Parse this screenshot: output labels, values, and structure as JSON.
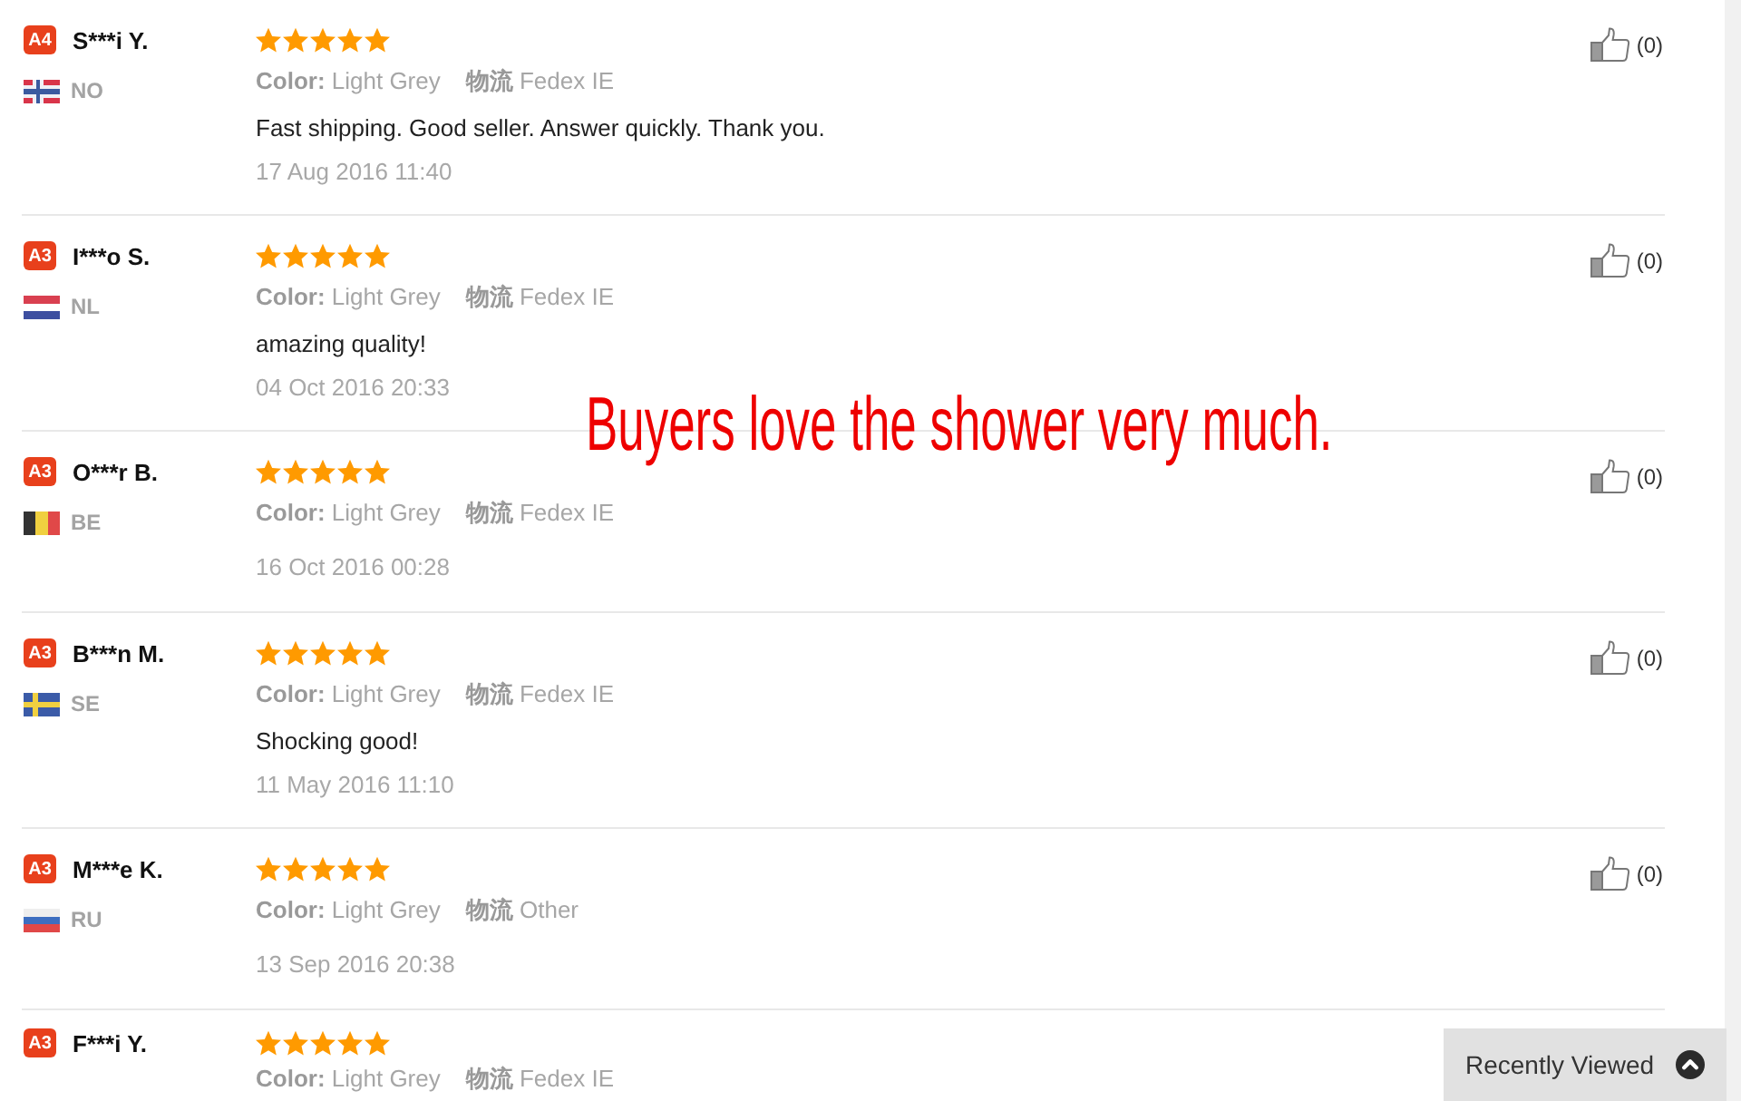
{
  "reviews": [
    {
      "badge": "A4",
      "name": "S***i Y.",
      "flag": {
        "kind": "cross",
        "parts": [
          {
            "color": "#d9354a"
          },
          {
            "color": "#f0f0f6"
          },
          {
            "color": "#3b5aa0"
          }
        ]
      },
      "country": "NO",
      "stars": 5,
      "attributes": [
        "**Color:** Light Grey",
        "**物流** Fedex IE"
      ],
      "comment": "Fast shipping. Good seller. Answer quickly. Thank you.",
      "date": "17 Aug 2016 11:40",
      "helpful": "(0)"
    },
    {
      "badge": "A3",
      "name": "I***o S.",
      "flag": {
        "kind": "horizontal",
        "parts": [
          {
            "color": "#d94050"
          },
          {
            "color": "#ffffff"
          },
          {
            "color": "#3d4fa0"
          }
        ]
      },
      "country": "NL",
      "stars": 5,
      "attributes": [
        "**Color:** Light Grey",
        "**物流** Fedex IE"
      ],
      "comment": "amazing quality!",
      "date": "04 Oct 2016 20:33",
      "helpful": "(0)"
    },
    {
      "badge": "A3",
      "name": "O***r B.",
      "flag": {
        "kind": "vertical",
        "parts": [
          {
            "color": "#333333"
          },
          {
            "color": "#f0d040"
          },
          {
            "color": "#e04848"
          }
        ]
      },
      "country": "BE",
      "stars": 5,
      "attributes": [
        "**Color:** Light Grey",
        "**物流** Fedex IE"
      ],
      "date": "16 Oct 2016 00:28",
      "helpful": "(0)"
    },
    {
      "badge": "A3",
      "name": "B***n M.",
      "flag": {
        "kind": "cross",
        "parts": [
          {
            "color": "#3b5ba8"
          },
          {
            "color": "#f0d040"
          }
        ]
      },
      "country": "SE",
      "stars": 5,
      "attributes": [
        "**Color:** Light Grey",
        "**物流** Fedex IE"
      ],
      "comment": "Shocking good!",
      "date": "11 May 2016 11:10",
      "helpful": "(0)"
    },
    {
      "badge": "A3",
      "name": "M***e K.",
      "flag": {
        "kind": "horizontal",
        "parts": [
          {
            "color": "#eeeeee"
          },
          {
            "color": "#3d6ec0"
          },
          {
            "color": "#e04848"
          }
        ]
      },
      "country": "RU",
      "stars": 5,
      "attributes": [
        "**Color:** Light Grey",
        "**物流** Other"
      ],
      "date": "13 Sep 2016 20:38",
      "helpful": "(0)"
    },
    {
      "badge": "A3",
      "name": "F***i Y.",
      "stars": 5,
      "attributes": [
        "**Color:** Light Grey",
        "**物流** Fedex IE"
      ]
    }
  ],
  "caption": "Buyers love the shower very much.",
  "recently_viewed": {
    "label": "Recently Viewed"
  }
}
